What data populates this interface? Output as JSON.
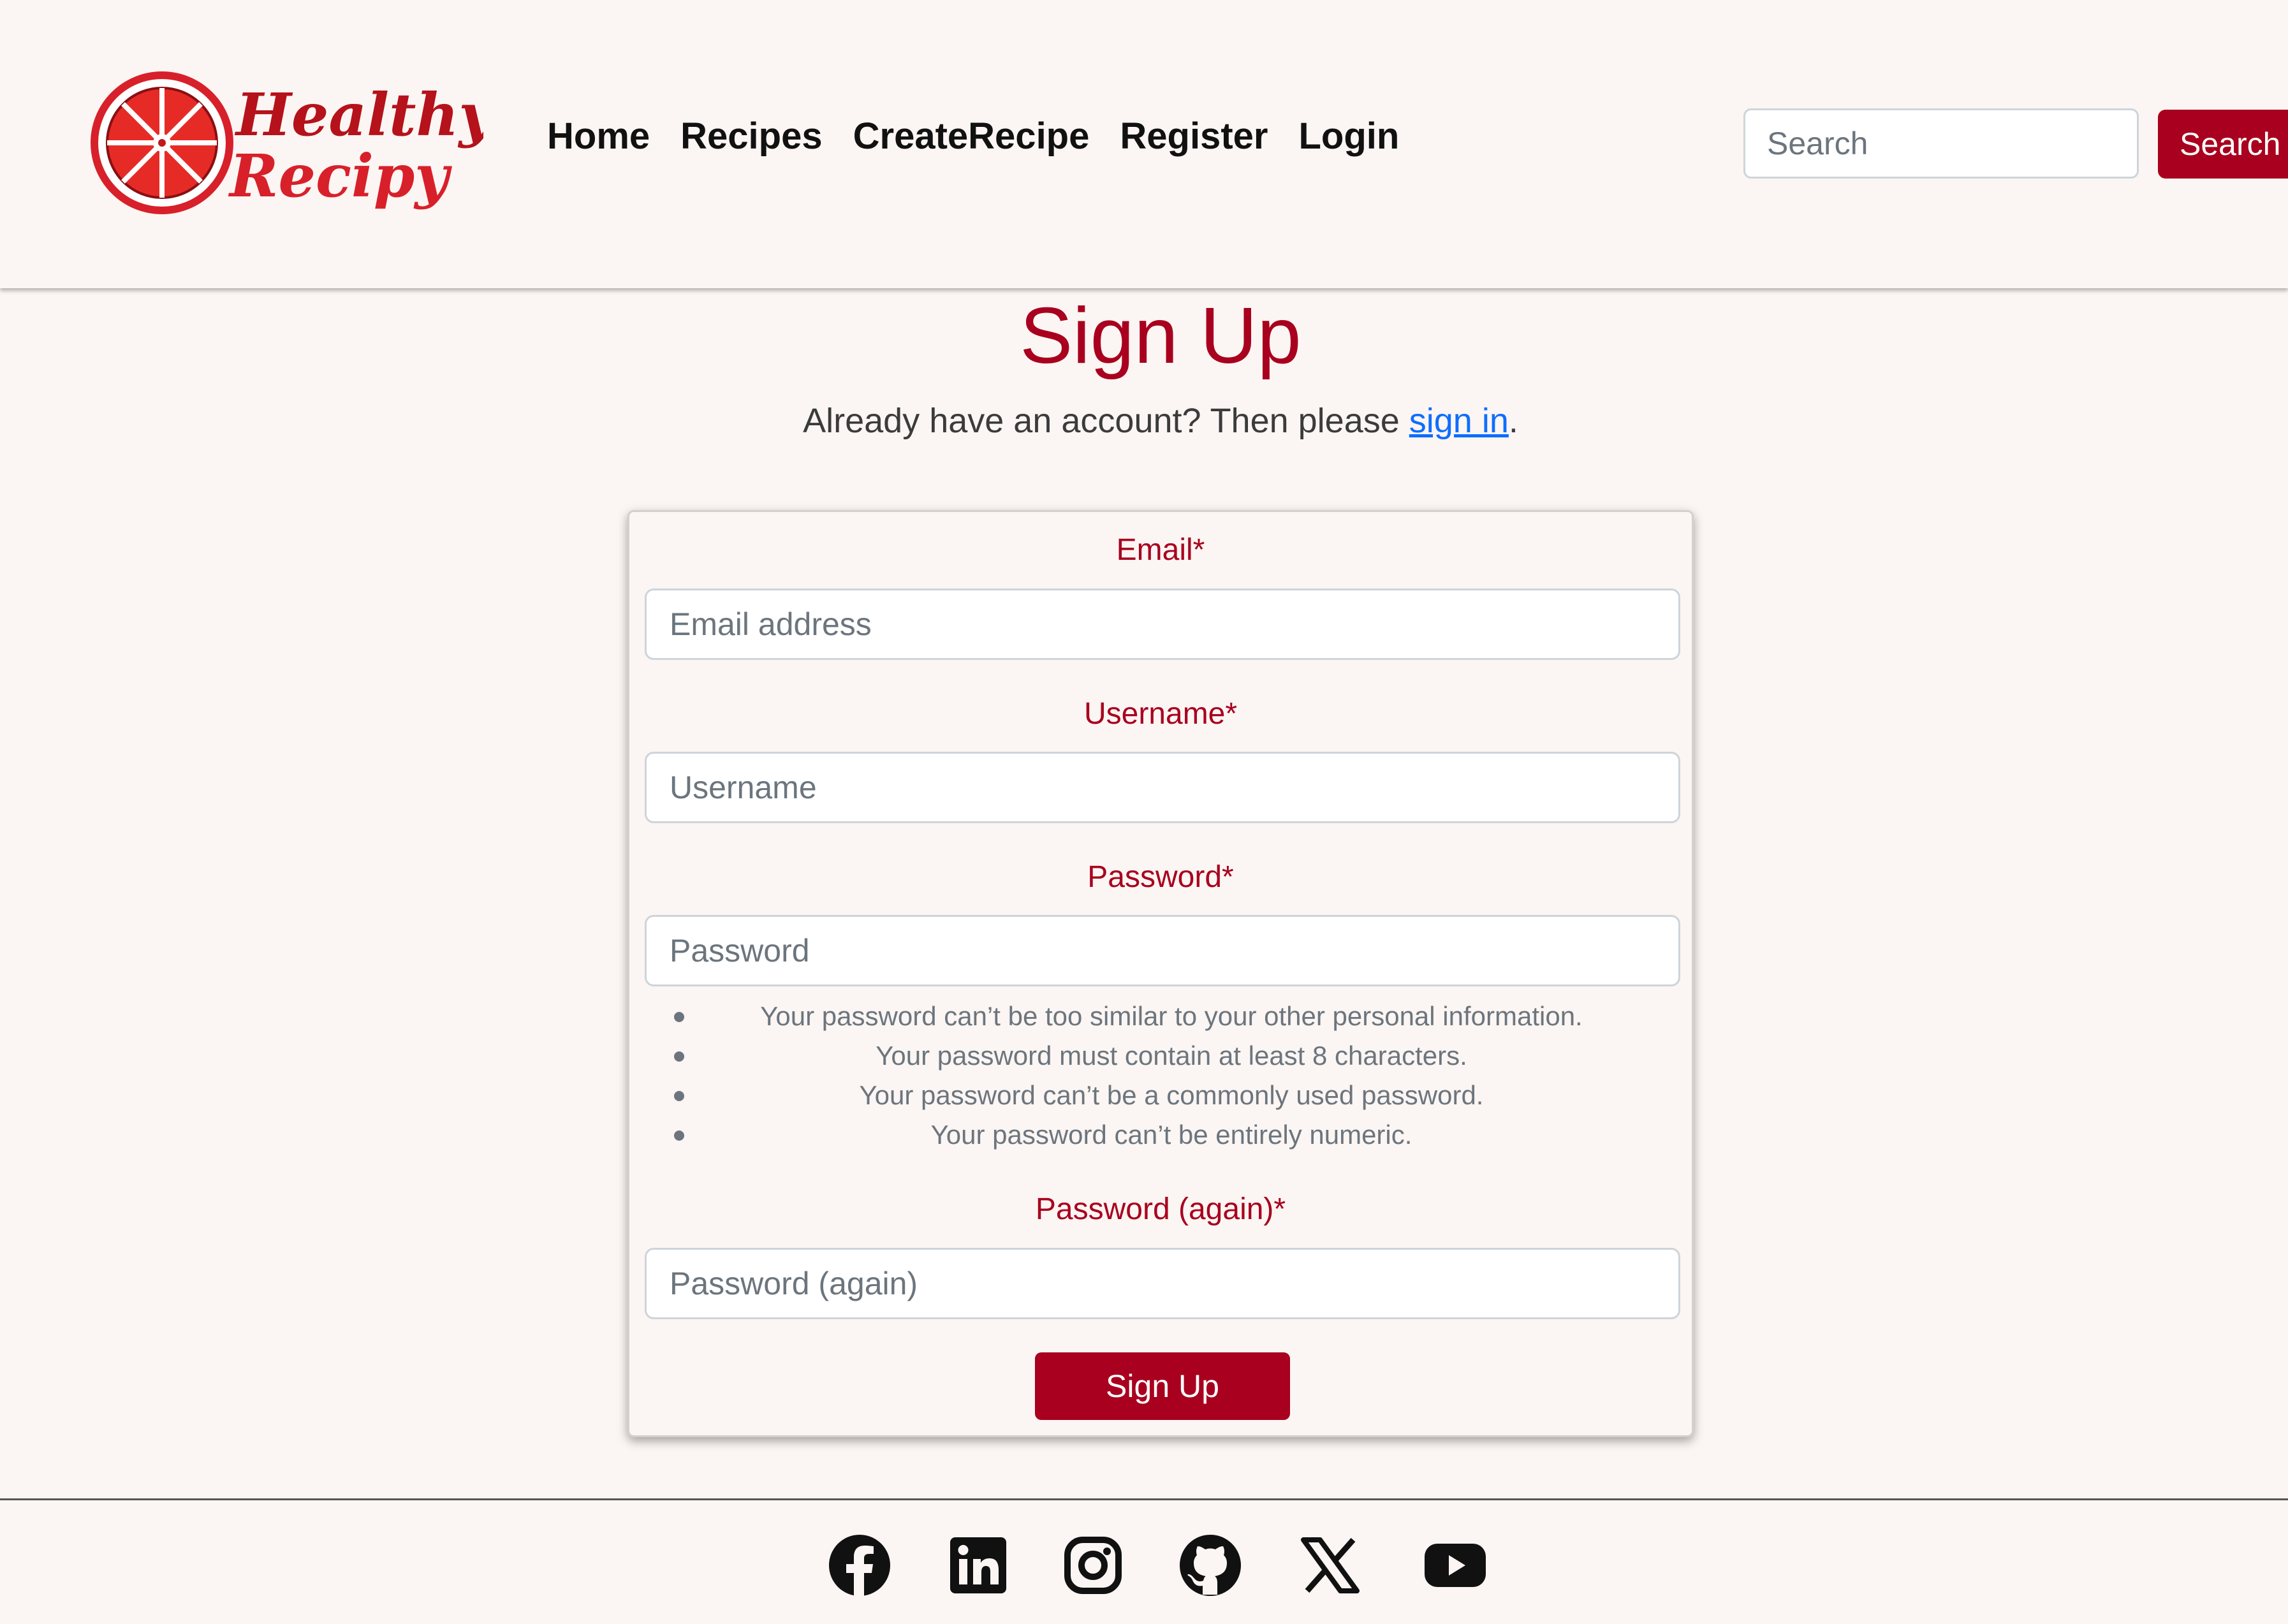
{
  "brand": {
    "logo_line1": "Healthy",
    "logo_line2": "Recipy",
    "color": "#a8001e"
  },
  "nav": {
    "items": [
      {
        "label": "Home"
      },
      {
        "label": "Recipes"
      },
      {
        "label": "CreateRecipe"
      },
      {
        "label": "Register"
      },
      {
        "label": "Login"
      }
    ]
  },
  "search": {
    "placeholder": "Search",
    "button_label": "Search"
  },
  "page": {
    "title": "Sign Up",
    "subtitle_prefix": "Already have an account? Then please ",
    "subtitle_link": "sign in",
    "subtitle_suffix": "."
  },
  "form": {
    "email": {
      "label": "Email*",
      "placeholder": "Email address"
    },
    "username": {
      "label": "Username*",
      "placeholder": "Username"
    },
    "password": {
      "label": "Password*",
      "placeholder": "Password"
    },
    "password_help": [
      "Your password can’t be too similar to your other personal information.",
      "Your password must contain at least 8 characters.",
      "Your password can’t be a commonly used password.",
      "Your password can’t be entirely numeric."
    ],
    "password_again": {
      "label": "Password (again)*",
      "placeholder": "Password (again)"
    },
    "submit_label": "Sign Up"
  },
  "footer": {
    "social_icons": [
      "facebook-icon",
      "linkedin-icon",
      "instagram-icon",
      "github-icon",
      "x-icon",
      "youtube-icon"
    ]
  }
}
